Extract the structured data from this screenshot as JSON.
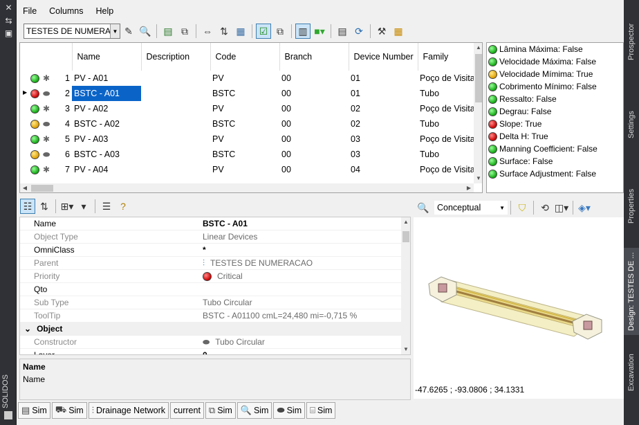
{
  "left_panel": {
    "title": "SOLIDOS"
  },
  "right_tabs": [
    {
      "label": "Prospector"
    },
    {
      "label": "Settings"
    },
    {
      "label": "Properties"
    },
    {
      "label": "Design: TESTES DE ..."
    },
    {
      "label": "Excavation"
    }
  ],
  "menu": {
    "file": "File",
    "columns": "Columns",
    "help": "Help"
  },
  "toolbar": {
    "network_select": "TESTES DE NUMERACAO",
    "icons": [
      "edit-icon",
      "zoom-icon",
      "network-icon",
      "copy-icon",
      "pan-icon",
      "sort-icon",
      "table-icon",
      "check-icon",
      "links-icon",
      "panels-icon",
      "cube-icon",
      "calculator-icon",
      "refresh-icon",
      "tools-icon",
      "grid-icon"
    ]
  },
  "grid": {
    "headers": {
      "name": "Name",
      "description": "Description",
      "code": "Code",
      "branch": "Branch",
      "device_number": "Device Number",
      "family": "Family"
    },
    "rows": [
      {
        "n": "1",
        "status": "green",
        "type": "manhole",
        "name": "PV - A01",
        "description": "",
        "code": "PV",
        "branch": "00",
        "device": "01",
        "family": "Poço de Visita"
      },
      {
        "n": "2",
        "status": "red",
        "type": "pipe",
        "name": "BSTC - A01",
        "description": "",
        "code": "BSTC",
        "branch": "00",
        "device": "01",
        "family": "Tubo"
      },
      {
        "n": "3",
        "status": "green",
        "type": "manhole",
        "name": "PV - A02",
        "description": "",
        "code": "PV",
        "branch": "00",
        "device": "02",
        "family": "Poço de Visita"
      },
      {
        "n": "4",
        "status": "yellow",
        "type": "pipe",
        "name": "BSTC - A02",
        "description": "",
        "code": "BSTC",
        "branch": "00",
        "device": "02",
        "family": "Tubo"
      },
      {
        "n": "5",
        "status": "green",
        "type": "manhole",
        "name": "PV - A03",
        "description": "",
        "code": "PV",
        "branch": "00",
        "device": "03",
        "family": "Poço de Visita"
      },
      {
        "n": "6",
        "status": "yellow",
        "type": "pipe",
        "name": "BSTC - A03",
        "description": "",
        "code": "BSTC",
        "branch": "00",
        "device": "03",
        "family": "Tubo"
      },
      {
        "n": "7",
        "status": "green",
        "type": "manhole",
        "name": "PV - A04",
        "description": "",
        "code": "PV",
        "branch": "00",
        "device": "04",
        "family": "Poço de Visita"
      }
    ]
  },
  "checks": [
    {
      "status": "green",
      "text": "Lâmina Máxima: False"
    },
    {
      "status": "green",
      "text": "Velocidade Máxima: False"
    },
    {
      "status": "yellow",
      "text": "Velocidade Mímima: True"
    },
    {
      "status": "green",
      "text": "Cobrimento Mínimo: False"
    },
    {
      "status": "green",
      "text": "Ressalto: False"
    },
    {
      "status": "green",
      "text": "Degrau: False"
    },
    {
      "status": "red",
      "text": "Slope: True"
    },
    {
      "status": "red",
      "text": "Delta H: True"
    },
    {
      "status": "green",
      "text": "Manning Coefficient: False"
    },
    {
      "status": "green",
      "text": "Surface: False"
    },
    {
      "status": "green",
      "text": "Surface Adjustment: False"
    }
  ],
  "properties": [
    {
      "key": "Name",
      "value": "BSTC - A01",
      "kind": "bold"
    },
    {
      "key": "Object Type",
      "value": "Linear Devices",
      "kind": "grey"
    },
    {
      "key": "OmniClass",
      "value": "*",
      "kind": "normal"
    },
    {
      "key": "Parent",
      "value": "TESTES DE NUMERACAO",
      "kind": "grey",
      "icon": "network-icon"
    },
    {
      "key": "Priority",
      "value": "Critical",
      "kind": "grey",
      "icon": "red-dot"
    },
    {
      "key": "Qto",
      "value": "",
      "kind": "normal"
    },
    {
      "key": "Sub Type",
      "value": "Tubo Circular",
      "kind": "grey"
    },
    {
      "key": "ToolTip",
      "value": "BSTC - A01100 cmL=24,480 mi=-0,715 %",
      "kind": "grey"
    }
  ],
  "property_category": "Object",
  "properties2": [
    {
      "key": "Constructor",
      "value": "Tubo Circular",
      "kind": "grey",
      "icon": "pipe-icon"
    },
    {
      "key": "Layer",
      "value": "0",
      "kind": "bold"
    }
  ],
  "description_box": {
    "title": "Name",
    "text": "Name"
  },
  "view3d": {
    "visual_style": "Conceptual",
    "coords": "-47.6265 ; -93.0806 ; 34.1331"
  },
  "bottom_tabs": [
    {
      "icon": "sheet-icon",
      "label": "Sim"
    },
    {
      "icon": "excavator-icon",
      "label": "Sim"
    },
    {
      "icon": "network-icon",
      "label": "Drainage Network"
    },
    {
      "icon": "",
      "label": "current"
    },
    {
      "icon": "export-icon",
      "label": "Sim"
    },
    {
      "icon": "zoom-icon",
      "label": "Sim"
    },
    {
      "icon": "pipe-icon",
      "label": "Sim"
    },
    {
      "icon": "cup-icon",
      "label": "Sim"
    }
  ]
}
